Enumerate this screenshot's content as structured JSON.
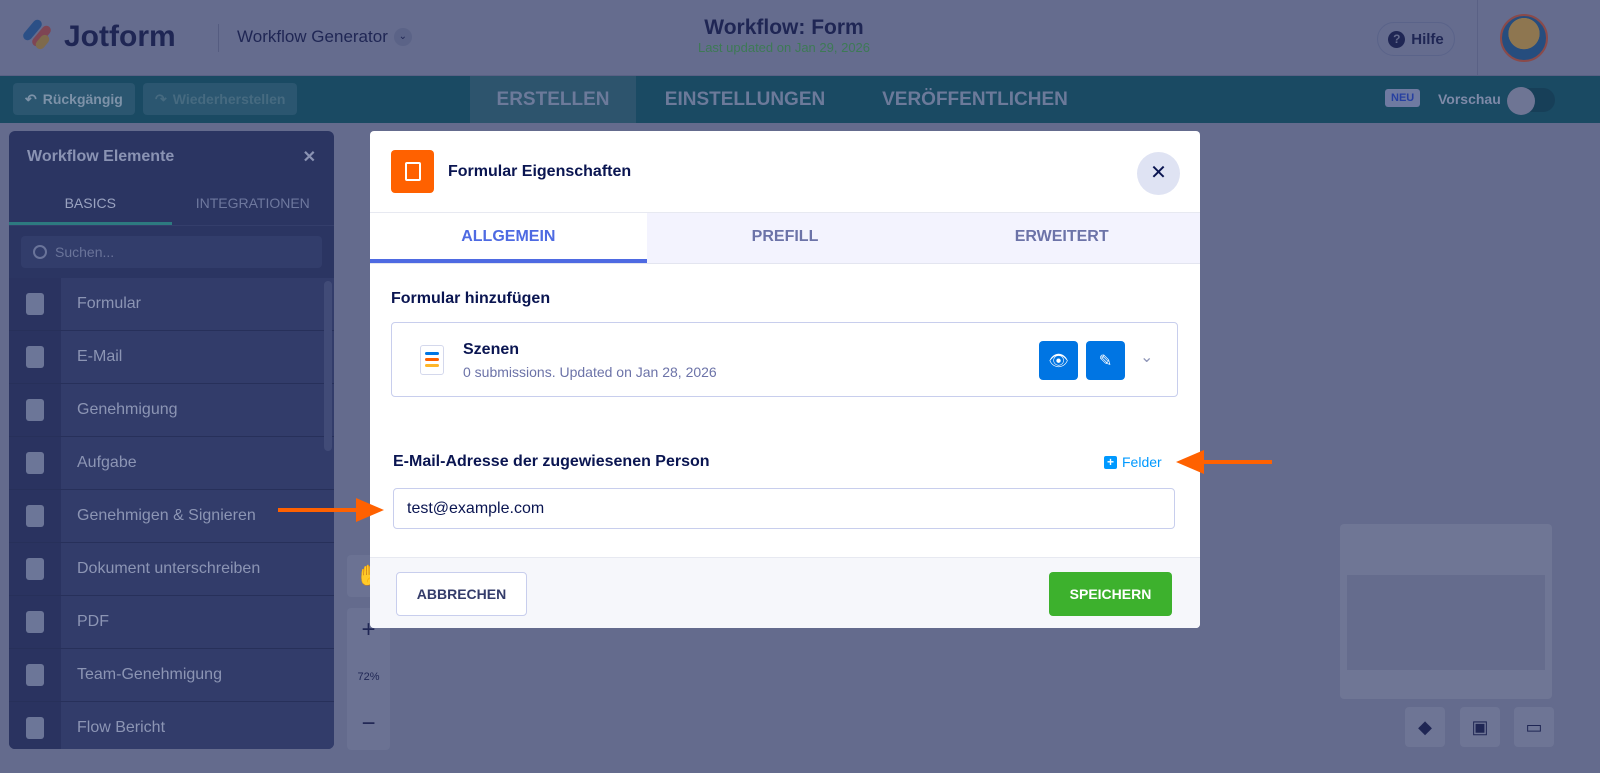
{
  "header": {
    "brand": "Jotform",
    "product": "Workflow Generator",
    "title": "Workflow: Form",
    "subtitle": "Last updated on Jan 29, 2026",
    "help": "Hilfe"
  },
  "toolbar": {
    "undo": "Rückgängig",
    "redo": "Wiederherstellen",
    "tabs": [
      "ERSTELLEN",
      "EINSTELLUNGEN",
      "VERÖFFENTLICHEN"
    ],
    "new_badge": "NEU",
    "preview": "Vorschau",
    "preview_on": false
  },
  "sidebar": {
    "title": "Workflow Elemente",
    "tabs": [
      "BASICS",
      "INTEGRATIONEN"
    ],
    "search_placeholder": "Suchen...",
    "items": [
      "Formular",
      "E-Mail",
      "Genehmigung",
      "Aufgabe",
      "Genehmigen & Signieren",
      "Dokument unterschreiben",
      "PDF",
      "Team-Genehmigung",
      "Flow Bericht"
    ]
  },
  "canvas": {
    "zoom": "72%"
  },
  "modal": {
    "title": "Formular Eigenschaften",
    "tabs": [
      "ALLGEMEIN",
      "PREFILL",
      "ERWEITERT"
    ],
    "add_form_label": "Formular hinzufügen",
    "form": {
      "name": "Szenen",
      "meta": "0 submissions. Updated on Jan 28, 2026"
    },
    "email_label": "E-Mail-Adresse der zugewiesenen Person",
    "fields_link": "Felder",
    "email_value": "test@example.com",
    "cancel": "ABBRECHEN",
    "save": "SPEICHERN"
  },
  "colors": {
    "accent": "#4e6ae2",
    "save": "#3db12d",
    "annotation": "#ff6100"
  }
}
